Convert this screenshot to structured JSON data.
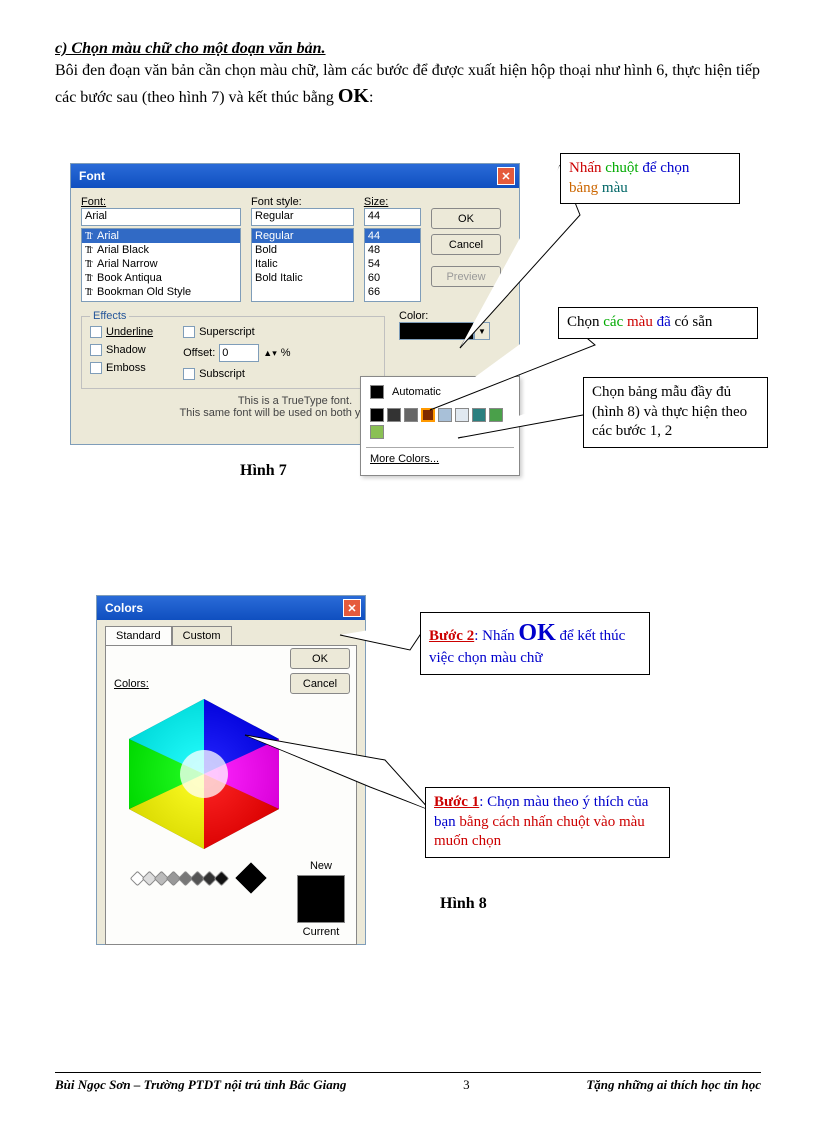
{
  "header": {
    "section_title": "c) Chọn màu chữ cho một đoạn văn bản.",
    "paragraph_a": "Bôi đen đoạn văn bản cần chọn màu chữ, làm các bước để được xuất hiện hộp thoại như hình 6, thực hiện tiếp các bước sau (theo hình 7) và kết thúc bằng ",
    "paragraph_ok": "OK",
    "paragraph_b": ":"
  },
  "font_dialog": {
    "title": "Font",
    "labels": {
      "font": "Font:",
      "style": "Font style:",
      "size": "Size:",
      "color": "Color:"
    },
    "font_value": "Arial",
    "style_value": "Regular",
    "size_value": "44",
    "font_list": [
      "Arial",
      "Arial Black",
      "Arial Narrow",
      "Book Antiqua",
      "Bookman Old Style"
    ],
    "style_list": [
      "Regular",
      "Bold",
      "Italic",
      "Bold Italic"
    ],
    "size_list": [
      "44",
      "48",
      "54",
      "60",
      "66"
    ],
    "buttons": {
      "ok": "OK",
      "cancel": "Cancel",
      "preview": "Preview"
    },
    "effects_legend": "Effects",
    "effects": {
      "underline": "Underline",
      "shadow": "Shadow",
      "emboss": "Emboss",
      "superscript": "Superscript",
      "subscript": "Subscript",
      "offset": "Offset:",
      "offset_val": "0",
      "offset_pct": "%"
    },
    "hint1": "This is a TrueType font.",
    "hint2": "This same font will be used on both your printer"
  },
  "flyout": {
    "automatic": "Automatic",
    "more": "More Colors...",
    "swatches": [
      "#000000",
      "#333333",
      "#666666",
      "#7f2a00",
      "#a8c0d8",
      "#e0e8f0",
      "#2a7f7f",
      "#4aa04a",
      "#8ac054"
    ]
  },
  "callouts": {
    "c1": {
      "w1": "Nhấn",
      "w2": "chuột",
      "w3": "để chọn",
      "w4": "bảng",
      "w5": "màu"
    },
    "c2": {
      "w1": "Chọn",
      "w2": "các",
      "w3": "màu",
      "w4": "đã",
      "w5": "có sẵn"
    },
    "c3": "Chọn bảng mẫu đầy đủ (hình 8) và thực hiện theo các bước 1, 2",
    "s2": {
      "label": "Bước 2",
      "t1": ": Nhấn ",
      "ok": "OK",
      "t2": " để kết thúc việc chọn màu chữ"
    },
    "s1": {
      "label": "Bước 1",
      "t1": ": Chọn màu theo ý thích của bạn ",
      "t2": "bằng cách nhấn chuột vào màu muốn chọn"
    }
  },
  "captions": {
    "h7": "Hình 7",
    "h8": "Hình 8"
  },
  "colors_dialog": {
    "title": "Colors",
    "tabs": {
      "standard": "Standard",
      "custom": "Custom"
    },
    "buttons": {
      "ok": "OK",
      "cancel": "Cancel"
    },
    "colors_label": "Colors:",
    "new": "New",
    "current": "Current"
  },
  "footer": {
    "left": "Bùi Ngọc Sơn – Trường PTDT nội trú tỉnh Bắc Giang",
    "page": "3",
    "right": "Tặng những ai thích học tin học"
  }
}
